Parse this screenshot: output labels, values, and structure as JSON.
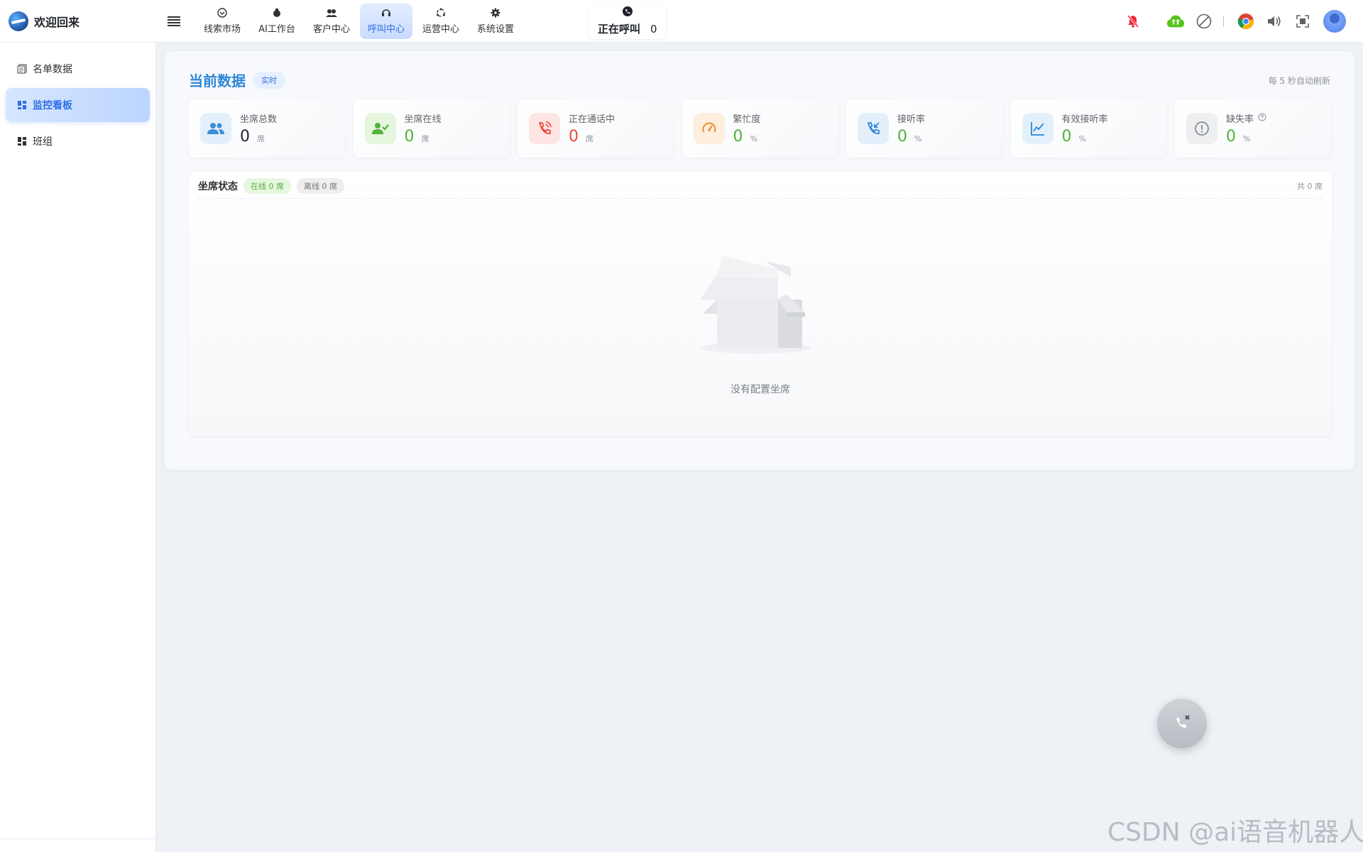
{
  "header": {
    "brand_title": "欢迎回来",
    "nav": [
      {
        "label": "线索市场",
        "icon": "clue-market-icon"
      },
      {
        "label": "AI工作台",
        "icon": "ai-workbench-icon"
      },
      {
        "label": "客户中心",
        "icon": "customers-icon"
      },
      {
        "label": "呼叫中心",
        "icon": "headset-icon",
        "active": true
      },
      {
        "label": "运营中心",
        "icon": "operations-icon"
      },
      {
        "label": "系统设置",
        "icon": "gear-icon"
      }
    ],
    "calling_label": "正在呼叫",
    "calling_count": "0"
  },
  "sidebar": {
    "items": [
      {
        "label": "名单数据",
        "icon": "list-icon"
      },
      {
        "label": "监控看板",
        "icon": "dashboard-icon",
        "active": true
      },
      {
        "label": "班组",
        "icon": "group-icon"
      }
    ]
  },
  "panel": {
    "title": "当前数据",
    "live_badge": "实时",
    "auto_refresh": "每 5 秒自动刷新",
    "stats": [
      {
        "label": "坐席总数",
        "value": "0",
        "unit": "席",
        "color": "#1f2329",
        "icon": "users-icon",
        "icon_bg": "#e3f0fb",
        "icon_color": "#3b8ed6"
      },
      {
        "label": "坐席在线",
        "value": "0",
        "unit": "席",
        "color": "#52b13a",
        "icon": "user-check-icon",
        "icon_bg": "#e5f5de",
        "icon_color": "#52b13a"
      },
      {
        "label": "正在通话中",
        "value": "0",
        "unit": "席",
        "color": "#e8473b",
        "icon": "phone-call-icon",
        "icon_bg": "#fde6e4",
        "icon_color": "#e8473b"
      },
      {
        "label": "繁忙度",
        "value": "0",
        "unit": "%",
        "color": "#52b13a",
        "icon": "speedometer-icon",
        "icon_bg": "#fdeede",
        "icon_color": "#f08c2b"
      },
      {
        "label": "接听率",
        "value": "0",
        "unit": "%",
        "color": "#52b13a",
        "icon": "phone-incoming-icon",
        "icon_bg": "#e3f0fb",
        "icon_color": "#2f86d6"
      },
      {
        "label": "有效接听率",
        "value": "0",
        "unit": "%",
        "color": "#52b13a",
        "icon": "trend-icon",
        "icon_bg": "#e3f0fb",
        "icon_color": "#2f86d6"
      },
      {
        "label": "缺失率",
        "value": "0",
        "unit": "%",
        "color": "#52b13a",
        "icon": "alert-circle-icon",
        "icon_bg": "#eeeff1",
        "icon_color": "#8a8f96",
        "help": true
      }
    ],
    "seats": {
      "title": "坐席状态",
      "online": "在线 0 席",
      "offline": "离线 0 席",
      "total": "共 0 席",
      "empty_text": "没有配置坐席"
    }
  },
  "watermark": "CSDN @ai语音机器人"
}
